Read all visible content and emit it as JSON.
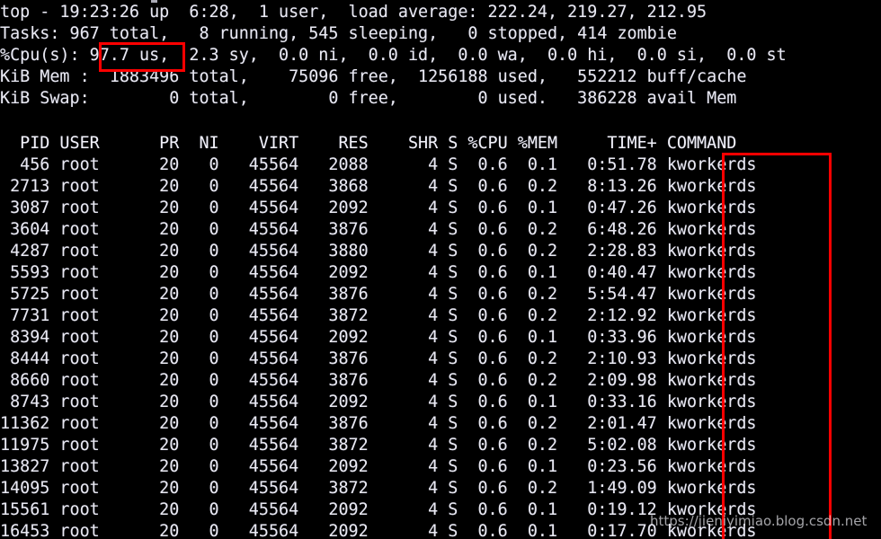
{
  "terminal": {
    "program": "top",
    "background_color": "#000000",
    "text_color": "#e9e9f2",
    "annotation_color": "#ff0000",
    "summary": {
      "uptime_line": "top - 19:23:26 up  6:28,  1 user,  load average: 222.24, 219.27, 212.95",
      "tasks_line": "Tasks: 967 total,   8 running, 545 sleeping,   0 stopped, 414 zombie",
      "cpu_line": "%Cpu(s): 97.7 us,  2.3 sy,  0.0 ni,  0.0 id,  0.0 wa,  0.0 hi,  0.0 si,  0.0 st",
      "mem_line": "KiB Mem :  1883496 total,    75096 free,  1256188 used,   552212 buff/cache",
      "swap_line": "KiB Swap:        0 total,        0 free,        0 used.   386228 avail Mem",
      "blank_line": "",
      "fields": {
        "time": "19:23:26",
        "up": "6:28",
        "users": "1 user",
        "load_average_1": "222.24",
        "load_average_5": "219.27",
        "load_average_15": "212.95",
        "tasks_total": "967",
        "tasks_running": "8",
        "tasks_sleeping": "545",
        "tasks_stopped": "0",
        "tasks_zombie": "414",
        "cpu_us": "97.7",
        "cpu_sy": "2.3",
        "cpu_ni": "0.0",
        "cpu_id": "0.0",
        "cpu_wa": "0.0",
        "cpu_hi": "0.0",
        "cpu_si": "0.0",
        "cpu_st": "0.0",
        "mem_total": "1883496",
        "mem_free": "75096",
        "mem_used": "1256188",
        "mem_buff_cache": "552212",
        "swap_total": "0",
        "swap_free": "0",
        "swap_used": "0",
        "swap_avail_mem": "386228"
      }
    },
    "table": {
      "header_line": "  PID USER      PR  NI    VIRT    RES    SHR S %CPU %MEM     TIME+ COMMAND",
      "columns": [
        "PID",
        "USER",
        "PR",
        "NI",
        "VIRT",
        "RES",
        "SHR",
        "S",
        "%CPU",
        "%MEM",
        "TIME+",
        "COMMAND"
      ],
      "rows": [
        "  456 root      20   0   45564   2088      4 S  0.6  0.1   0:51.78 kworkerds",
        " 2713 root      20   0   45564   3868      4 S  0.6  0.2   8:13.26 kworkerds",
        " 3087 root      20   0   45564   2092      4 S  0.6  0.1   0:47.26 kworkerds",
        " 3604 root      20   0   45564   3876      4 S  0.6  0.2   6:48.26 kworkerds",
        " 4287 root      20   0   45564   3880      4 S  0.6  0.2   2:28.83 kworkerds",
        " 5593 root      20   0   45564   2092      4 S  0.6  0.1   0:40.47 kworkerds",
        " 5725 root      20   0   45564   3876      4 S  0.6  0.2   5:54.47 kworkerds",
        " 7731 root      20   0   45564   3872      4 S  0.6  0.2   2:12.92 kworkerds",
        " 8394 root      20   0   45564   2092      4 S  0.6  0.1   0:33.96 kworkerds",
        " 8444 root      20   0   45564   3876      4 S  0.6  0.2   2:10.93 kworkerds",
        " 8660 root      20   0   45564   3876      4 S  0.6  0.2   2:09.98 kworkerds",
        " 8743 root      20   0   45564   2092      4 S  0.6  0.1   0:33.16 kworkerds",
        "11362 root      20   0   45564   3876      4 S  0.6  0.2   2:01.47 kworkerds",
        "11975 root      20   0   45564   3872      4 S  0.6  0.2   5:02.08 kworkerds",
        "13827 root      20   0   45564   2092      4 S  0.6  0.1   0:23.56 kworkerds",
        "14095 root      20   0   45564   3872      4 S  0.6  0.2   1:49.09 kworkerds",
        "15561 root      20   0   45564   2092      4 S  0.6  0.1   0:19.12 kworkerds",
        "16453 root      20   0   45564   2092      4 S  0.6  0.1   0:17.70 kworkerds"
      ],
      "row_records": [
        {
          "pid": "456",
          "user": "root",
          "pr": "20",
          "ni": "0",
          "virt": "45564",
          "res": "2088",
          "shr": "4",
          "s": "S",
          "cpu": "0.6",
          "mem": "0.1",
          "time": "0:51.78",
          "command": "kworkerds"
        },
        {
          "pid": "2713",
          "user": "root",
          "pr": "20",
          "ni": "0",
          "virt": "45564",
          "res": "3868",
          "shr": "4",
          "s": "S",
          "cpu": "0.6",
          "mem": "0.2",
          "time": "8:13.26",
          "command": "kworkerds"
        },
        {
          "pid": "3087",
          "user": "root",
          "pr": "20",
          "ni": "0",
          "virt": "45564",
          "res": "2092",
          "shr": "4",
          "s": "S",
          "cpu": "0.6",
          "mem": "0.1",
          "time": "0:47.26",
          "command": "kworkerds"
        },
        {
          "pid": "3604",
          "user": "root",
          "pr": "20",
          "ni": "0",
          "virt": "45564",
          "res": "3876",
          "shr": "4",
          "s": "S",
          "cpu": "0.6",
          "mem": "0.2",
          "time": "6:48.26",
          "command": "kworkerds"
        },
        {
          "pid": "4287",
          "user": "root",
          "pr": "20",
          "ni": "0",
          "virt": "45564",
          "res": "3880",
          "shr": "4",
          "s": "S",
          "cpu": "0.6",
          "mem": "0.2",
          "time": "2:28.83",
          "command": "kworkerds"
        },
        {
          "pid": "5593",
          "user": "root",
          "pr": "20",
          "ni": "0",
          "virt": "45564",
          "res": "2092",
          "shr": "4",
          "s": "S",
          "cpu": "0.6",
          "mem": "0.1",
          "time": "0:40.47",
          "command": "kworkerds"
        },
        {
          "pid": "5725",
          "user": "root",
          "pr": "20",
          "ni": "0",
          "virt": "45564",
          "res": "3876",
          "shr": "4",
          "s": "S",
          "cpu": "0.6",
          "mem": "0.2",
          "time": "5:54.47",
          "command": "kworkerds"
        },
        {
          "pid": "7731",
          "user": "root",
          "pr": "20",
          "ni": "0",
          "virt": "45564",
          "res": "3872",
          "shr": "4",
          "s": "S",
          "cpu": "0.6",
          "mem": "0.2",
          "time": "2:12.92",
          "command": "kworkerds"
        },
        {
          "pid": "8394",
          "user": "root",
          "pr": "20",
          "ni": "0",
          "virt": "45564",
          "res": "2092",
          "shr": "4",
          "s": "S",
          "cpu": "0.6",
          "mem": "0.1",
          "time": "0:33.96",
          "command": "kworkerds"
        },
        {
          "pid": "8444",
          "user": "root",
          "pr": "20",
          "ni": "0",
          "virt": "45564",
          "res": "3876",
          "shr": "4",
          "s": "S",
          "cpu": "0.6",
          "mem": "0.2",
          "time": "2:10.93",
          "command": "kworkerds"
        },
        {
          "pid": "8660",
          "user": "root",
          "pr": "20",
          "ni": "0",
          "virt": "45564",
          "res": "3876",
          "shr": "4",
          "s": "S",
          "cpu": "0.6",
          "mem": "0.2",
          "time": "2:09.98",
          "command": "kworkerds"
        },
        {
          "pid": "8743",
          "user": "root",
          "pr": "20",
          "ni": "0",
          "virt": "45564",
          "res": "2092",
          "shr": "4",
          "s": "S",
          "cpu": "0.6",
          "mem": "0.1",
          "time": "0:33.16",
          "command": "kworkerds"
        },
        {
          "pid": "11362",
          "user": "root",
          "pr": "20",
          "ni": "0",
          "virt": "45564",
          "res": "3876",
          "shr": "4",
          "s": "S",
          "cpu": "0.6",
          "mem": "0.2",
          "time": "2:01.47",
          "command": "kworkerds"
        },
        {
          "pid": "11975",
          "user": "root",
          "pr": "20",
          "ni": "0",
          "virt": "45564",
          "res": "3872",
          "shr": "4",
          "s": "S",
          "cpu": "0.6",
          "mem": "0.2",
          "time": "5:02.08",
          "command": "kworkerds"
        },
        {
          "pid": "13827",
          "user": "root",
          "pr": "20",
          "ni": "0",
          "virt": "45564",
          "res": "2092",
          "shr": "4",
          "s": "S",
          "cpu": "0.6",
          "mem": "0.1",
          "time": "0:23.56",
          "command": "kworkerds"
        },
        {
          "pid": "14095",
          "user": "root",
          "pr": "20",
          "ni": "0",
          "virt": "45564",
          "res": "3872",
          "shr": "4",
          "s": "S",
          "cpu": "0.6",
          "mem": "0.2",
          "time": "1:49.09",
          "command": "kworkerds"
        },
        {
          "pid": "15561",
          "user": "root",
          "pr": "20",
          "ni": "0",
          "virt": "45564",
          "res": "2092",
          "shr": "4",
          "s": "S",
          "cpu": "0.6",
          "mem": "0.1",
          "time": "0:19.12",
          "command": "kworkerds"
        },
        {
          "pid": "16453",
          "user": "root",
          "pr": "20",
          "ni": "0",
          "virt": "45564",
          "res": "2092",
          "shr": "4",
          "s": "S",
          "cpu": "0.6",
          "mem": "0.1",
          "time": "0:17.70",
          "command": "kworkerds"
        }
      ]
    },
    "annotations": {
      "cpu_highlight_label": "97.7 us,",
      "command_highlight_label": "kworkerds"
    },
    "watermark": "https://jieniyimiao.blog.csdn.net"
  }
}
